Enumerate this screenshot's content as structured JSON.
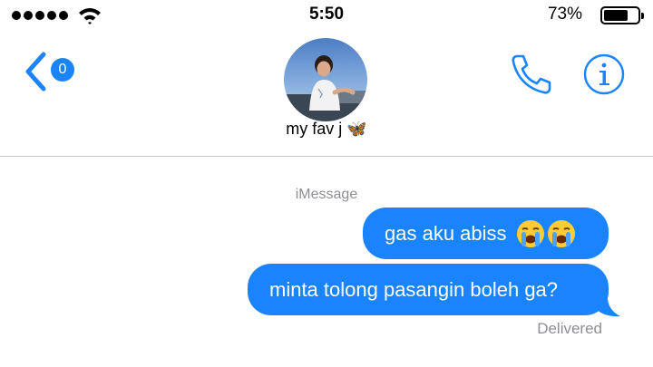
{
  "status_bar": {
    "time": "5:50",
    "battery_percent": "73%",
    "battery_level": 0.73,
    "signal_bars": 5
  },
  "nav": {
    "back_badge": "0",
    "contact_name": "my fav j",
    "contact_name_emoji": "🦋",
    "phone_icon": "phone-icon",
    "info_icon": "info-icon"
  },
  "thread": {
    "service_label": "iMessage",
    "messages": [
      {
        "text": "gas aku abiss",
        "emoji": "😭😭",
        "sender": "me"
      },
      {
        "text": "minta tolong pasangin boleh ga?",
        "sender": "me"
      }
    ],
    "receipt": "Delivered"
  },
  "colors": {
    "accent": "#1a84ff",
    "secondary_text": "#8e8e93"
  }
}
